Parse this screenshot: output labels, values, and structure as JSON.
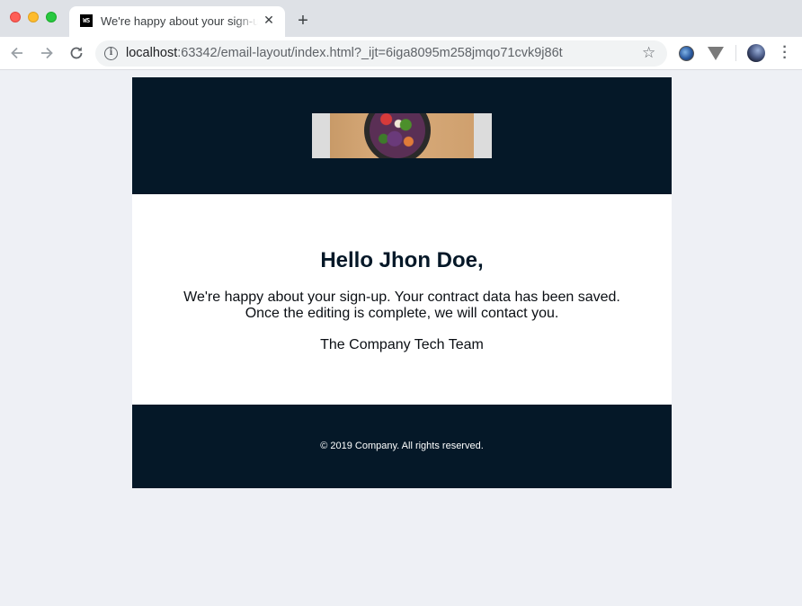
{
  "browser": {
    "tab_title": "We're happy about your sign-up",
    "tab_favicon_text": "WS",
    "url_host": "localhost",
    "url_rest": ":63342/email-layout/index.html?_ijt=6iga8095m258jmqo71cvk9j86t"
  },
  "email": {
    "header_image": "salad-bowl-photo",
    "greeting": "Hello Jhon Doe,",
    "message_line1": "We're happy about your sign-up. Your contract data has been saved.",
    "message_line2": "Once the editing is complete, we will contact you.",
    "signature": "The Company Tech Team",
    "copyright": "© 2019 Company. All rights reserved."
  },
  "colors": {
    "header_bg": "#051828",
    "footer_bg": "#051828",
    "page_bg": "#eef0f5"
  }
}
